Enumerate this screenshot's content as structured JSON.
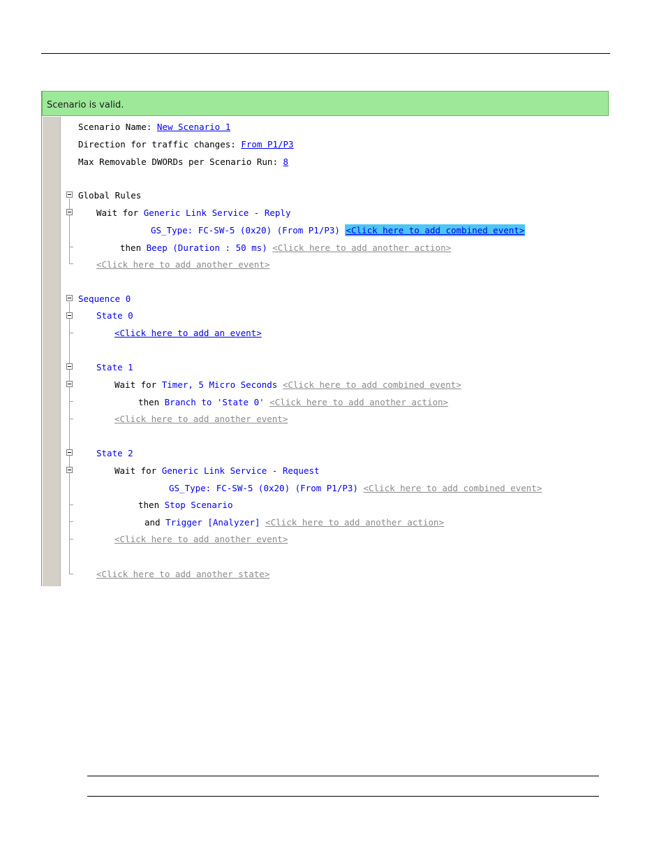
{
  "status": {
    "text": "Scenario is valid."
  },
  "header": {
    "name_label": "Scenario Name:",
    "name_value": "New Scenario 1",
    "direction_label": "Direction for traffic changes:",
    "direction_value": "From P1/P3",
    "max_label": "Max Removable DWORDs per Scenario Run:",
    "max_value": "8"
  },
  "global_rules": {
    "title": "Global Rules",
    "wait_for": "Wait for",
    "event": "Generic Link Service - Reply",
    "gs_type": "GS_Type: FC-SW-5 (0x20) (From P1/P3)",
    "add_combined": "<Click here to add combined event>",
    "then": "then",
    "action": "Beep (Duration : 50 ms)",
    "add_action": "<Click here to add another action>",
    "add_event": "<Click here to add another event>"
  },
  "sequence": {
    "title": "Sequence 0",
    "state0": {
      "title": "State 0",
      "add_event": "<Click here to add an event>"
    },
    "state1": {
      "title": "State 1",
      "wait_for": "Wait for",
      "event": "Timer, 5 Micro Seconds",
      "add_combined": "<Click here to add combined event>",
      "then": "then",
      "action": "Branch to 'State 0'",
      "add_action": "<Click here to add another action>",
      "add_event": "<Click here to add another event>"
    },
    "state2": {
      "title": "State 2",
      "wait_for": "Wait for",
      "event": "Generic Link Service - Request",
      "gs_type": "GS_Type: FC-SW-5 (0x20) (From P1/P3)",
      "add_combined": "<Click here to add combined event>",
      "then": "then",
      "action1": "Stop Scenario",
      "and": "and",
      "action2": "Trigger [Analyzer]",
      "add_action": "<Click here to add another action>",
      "add_event": "<Click here to add another event>"
    },
    "add_state": "<Click here to add another state>"
  }
}
